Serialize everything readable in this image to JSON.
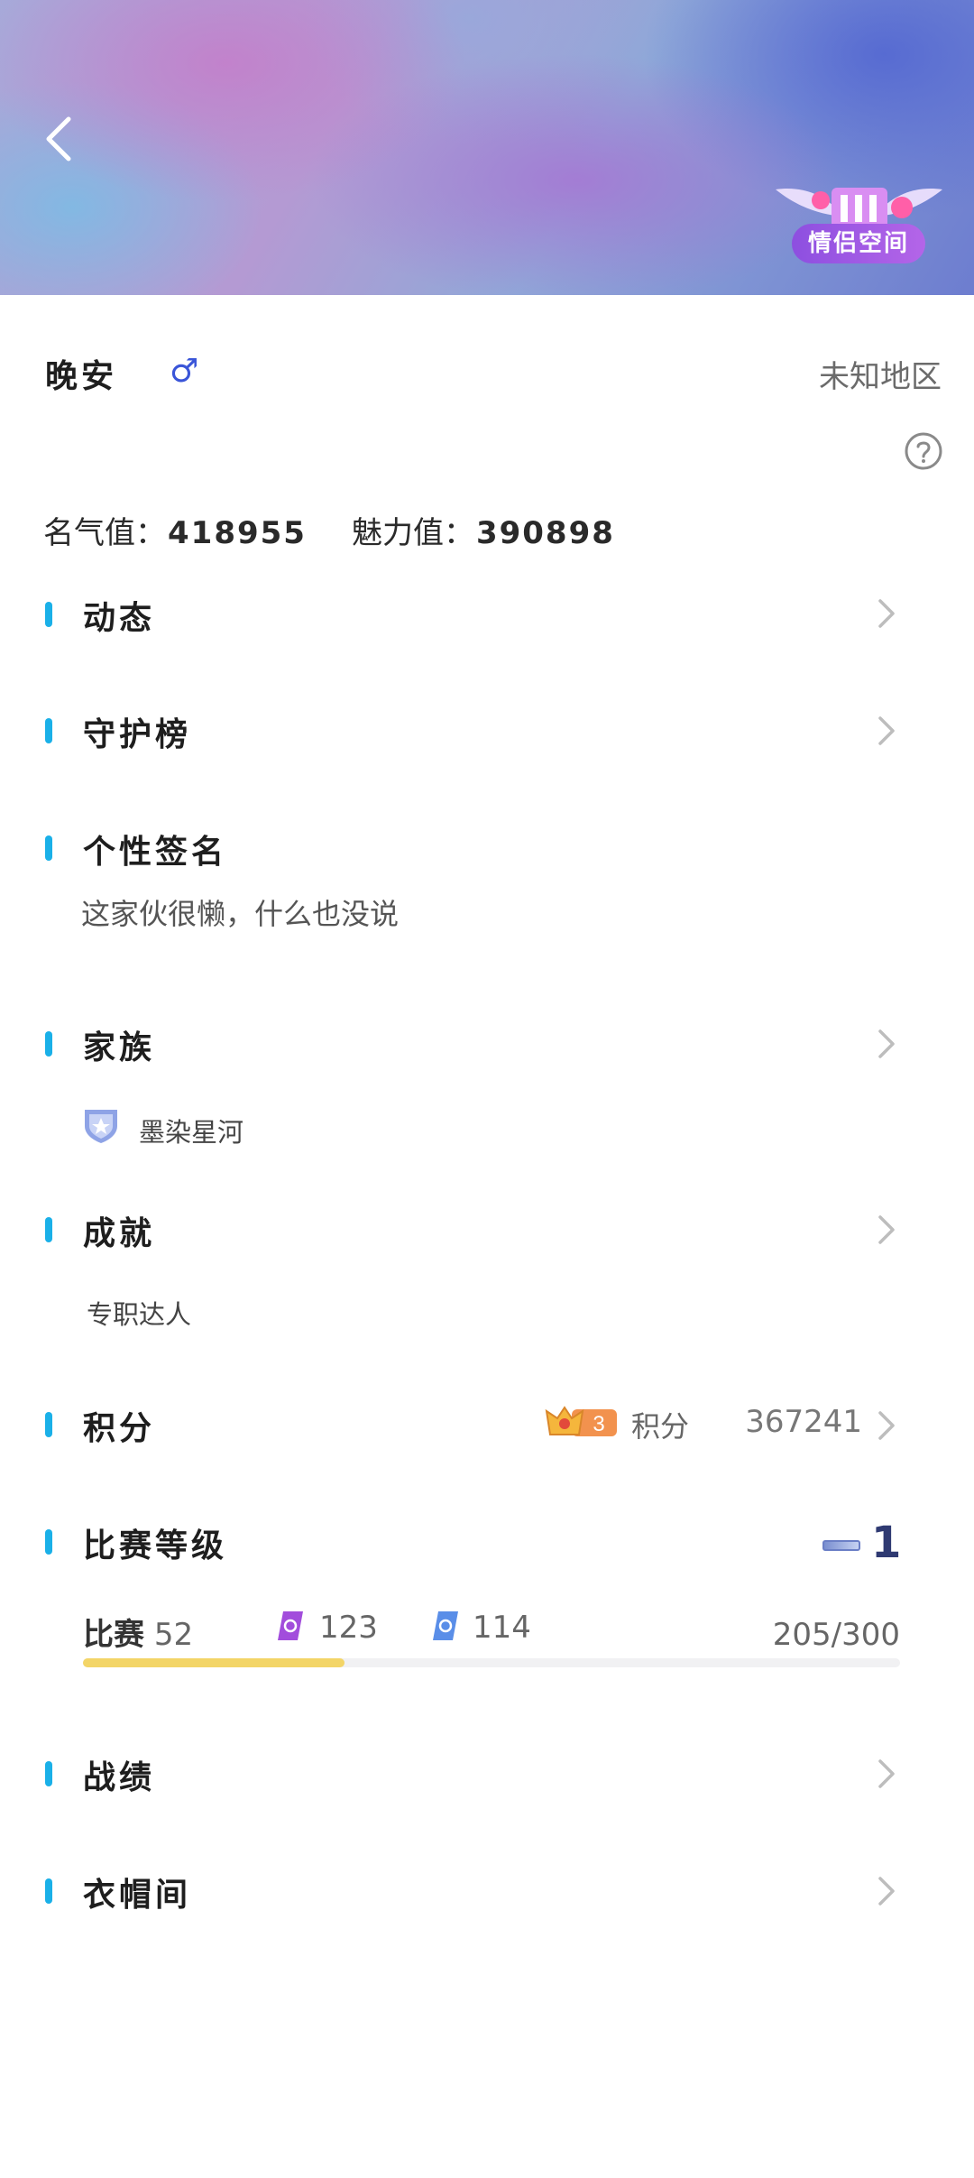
{
  "header": {
    "couple_space_label": "情侣空间"
  },
  "profile": {
    "name": "晚安",
    "gender_symbol": "♂",
    "region": "未知地区",
    "fame_label": "名气值：",
    "fame_value": "418955",
    "charm_label": "魅力值：",
    "charm_value": "390898"
  },
  "sections": {
    "moments": {
      "title": "动态"
    },
    "guard_rank": {
      "title": "守护榜"
    },
    "signature": {
      "title": "个性签名",
      "text": "这家伙很懒，什么也没说"
    },
    "family": {
      "title": "家族",
      "family_name": "墨染星河"
    },
    "achievement": {
      "title": "成就",
      "text": "专职达人"
    },
    "points": {
      "title": "积分",
      "badge_level": "3",
      "label": "积分",
      "value": "367241"
    },
    "match_level": {
      "title": "比赛等级",
      "level": "1",
      "match_label": "比赛",
      "match_count": "52",
      "purple_ticket_count": "123",
      "blue_ticket_count": "114",
      "progress_text": "205/300",
      "progress_fraction": 0.32
    },
    "record": {
      "title": "战绩"
    },
    "wardrobe": {
      "title": "衣帽间"
    }
  },
  "colors": {
    "accent_bar": "#1ab0e8",
    "progress_fill": "#f3d567",
    "gender": "#3a55d8",
    "level_number": "#2f3a72"
  },
  "icons": [
    "back-arrow-icon",
    "couple-space-wings-icon",
    "male-gender-icon",
    "help-icon",
    "chevron-right-icon",
    "family-shield-icon",
    "points-rank-badge-icon",
    "level-bar-icon",
    "purple-ticket-icon",
    "blue-ticket-icon"
  ]
}
